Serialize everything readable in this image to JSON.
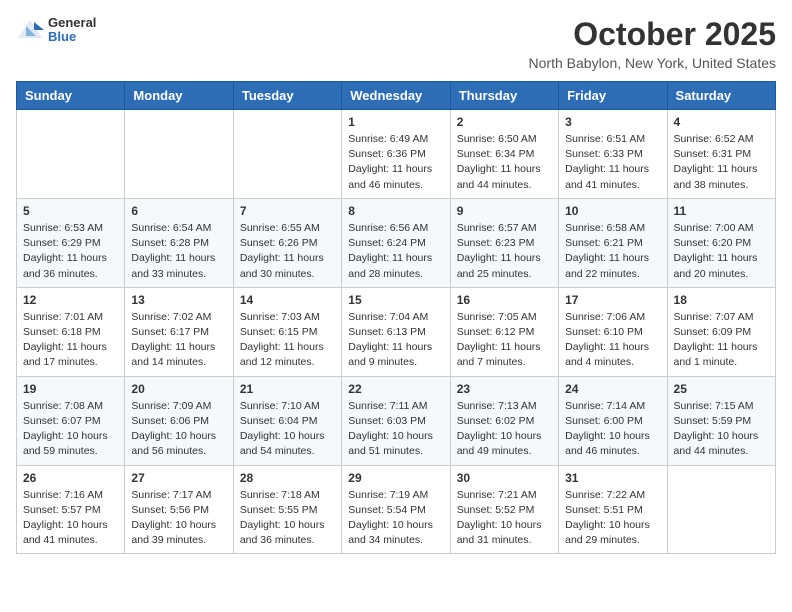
{
  "header": {
    "logo": {
      "general": "General",
      "blue": "Blue"
    },
    "month": "October 2025",
    "location": "North Babylon, New York, United States"
  },
  "weekdays": [
    "Sunday",
    "Monday",
    "Tuesday",
    "Wednesday",
    "Thursday",
    "Friday",
    "Saturday"
  ],
  "weeks": [
    [
      {
        "day": "",
        "info": ""
      },
      {
        "day": "",
        "info": ""
      },
      {
        "day": "",
        "info": ""
      },
      {
        "day": "1",
        "info": "Sunrise: 6:49 AM\nSunset: 6:36 PM\nDaylight: 11 hours\nand 46 minutes."
      },
      {
        "day": "2",
        "info": "Sunrise: 6:50 AM\nSunset: 6:34 PM\nDaylight: 11 hours\nand 44 minutes."
      },
      {
        "day": "3",
        "info": "Sunrise: 6:51 AM\nSunset: 6:33 PM\nDaylight: 11 hours\nand 41 minutes."
      },
      {
        "day": "4",
        "info": "Sunrise: 6:52 AM\nSunset: 6:31 PM\nDaylight: 11 hours\nand 38 minutes."
      }
    ],
    [
      {
        "day": "5",
        "info": "Sunrise: 6:53 AM\nSunset: 6:29 PM\nDaylight: 11 hours\nand 36 minutes."
      },
      {
        "day": "6",
        "info": "Sunrise: 6:54 AM\nSunset: 6:28 PM\nDaylight: 11 hours\nand 33 minutes."
      },
      {
        "day": "7",
        "info": "Sunrise: 6:55 AM\nSunset: 6:26 PM\nDaylight: 11 hours\nand 30 minutes."
      },
      {
        "day": "8",
        "info": "Sunrise: 6:56 AM\nSunset: 6:24 PM\nDaylight: 11 hours\nand 28 minutes."
      },
      {
        "day": "9",
        "info": "Sunrise: 6:57 AM\nSunset: 6:23 PM\nDaylight: 11 hours\nand 25 minutes."
      },
      {
        "day": "10",
        "info": "Sunrise: 6:58 AM\nSunset: 6:21 PM\nDaylight: 11 hours\nand 22 minutes."
      },
      {
        "day": "11",
        "info": "Sunrise: 7:00 AM\nSunset: 6:20 PM\nDaylight: 11 hours\nand 20 minutes."
      }
    ],
    [
      {
        "day": "12",
        "info": "Sunrise: 7:01 AM\nSunset: 6:18 PM\nDaylight: 11 hours\nand 17 minutes."
      },
      {
        "day": "13",
        "info": "Sunrise: 7:02 AM\nSunset: 6:17 PM\nDaylight: 11 hours\nand 14 minutes."
      },
      {
        "day": "14",
        "info": "Sunrise: 7:03 AM\nSunset: 6:15 PM\nDaylight: 11 hours\nand 12 minutes."
      },
      {
        "day": "15",
        "info": "Sunrise: 7:04 AM\nSunset: 6:13 PM\nDaylight: 11 hours\nand 9 minutes."
      },
      {
        "day": "16",
        "info": "Sunrise: 7:05 AM\nSunset: 6:12 PM\nDaylight: 11 hours\nand 7 minutes."
      },
      {
        "day": "17",
        "info": "Sunrise: 7:06 AM\nSunset: 6:10 PM\nDaylight: 11 hours\nand 4 minutes."
      },
      {
        "day": "18",
        "info": "Sunrise: 7:07 AM\nSunset: 6:09 PM\nDaylight: 11 hours\nand 1 minute."
      }
    ],
    [
      {
        "day": "19",
        "info": "Sunrise: 7:08 AM\nSunset: 6:07 PM\nDaylight: 10 hours\nand 59 minutes."
      },
      {
        "day": "20",
        "info": "Sunrise: 7:09 AM\nSunset: 6:06 PM\nDaylight: 10 hours\nand 56 minutes."
      },
      {
        "day": "21",
        "info": "Sunrise: 7:10 AM\nSunset: 6:04 PM\nDaylight: 10 hours\nand 54 minutes."
      },
      {
        "day": "22",
        "info": "Sunrise: 7:11 AM\nSunset: 6:03 PM\nDaylight: 10 hours\nand 51 minutes."
      },
      {
        "day": "23",
        "info": "Sunrise: 7:13 AM\nSunset: 6:02 PM\nDaylight: 10 hours\nand 49 minutes."
      },
      {
        "day": "24",
        "info": "Sunrise: 7:14 AM\nSunset: 6:00 PM\nDaylight: 10 hours\nand 46 minutes."
      },
      {
        "day": "25",
        "info": "Sunrise: 7:15 AM\nSunset: 5:59 PM\nDaylight: 10 hours\nand 44 minutes."
      }
    ],
    [
      {
        "day": "26",
        "info": "Sunrise: 7:16 AM\nSunset: 5:57 PM\nDaylight: 10 hours\nand 41 minutes."
      },
      {
        "day": "27",
        "info": "Sunrise: 7:17 AM\nSunset: 5:56 PM\nDaylight: 10 hours\nand 39 minutes."
      },
      {
        "day": "28",
        "info": "Sunrise: 7:18 AM\nSunset: 5:55 PM\nDaylight: 10 hours\nand 36 minutes."
      },
      {
        "day": "29",
        "info": "Sunrise: 7:19 AM\nSunset: 5:54 PM\nDaylight: 10 hours\nand 34 minutes."
      },
      {
        "day": "30",
        "info": "Sunrise: 7:21 AM\nSunset: 5:52 PM\nDaylight: 10 hours\nand 31 minutes."
      },
      {
        "day": "31",
        "info": "Sunrise: 7:22 AM\nSunset: 5:51 PM\nDaylight: 10 hours\nand 29 minutes."
      },
      {
        "day": "",
        "info": ""
      }
    ]
  ]
}
